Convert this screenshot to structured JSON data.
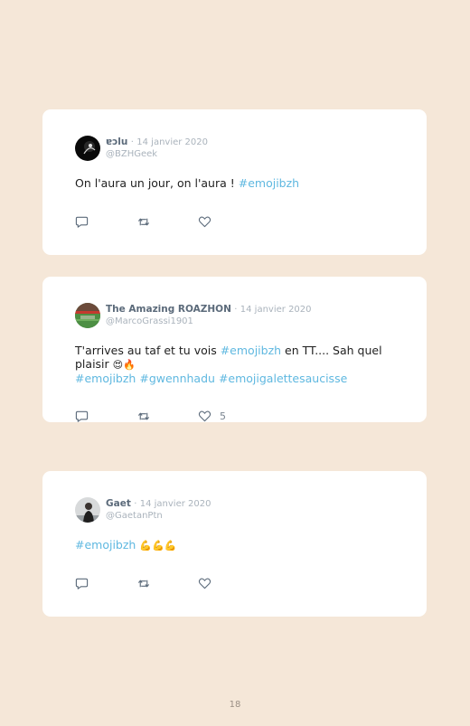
{
  "tweets": [
    {
      "author": "ɐɔlu",
      "separator": "·",
      "date": "14 janvier 2020",
      "handle": "@BZHGeek",
      "text_plain": "On l'aura un jour, on l'aura ! ",
      "hashtag": "#emojibzh",
      "likes": ""
    },
    {
      "author": "The Amazing ROAZHON",
      "separator": "·",
      "date": "14 janvier 2020",
      "handle": "@MarcoGrassi1901",
      "text_before": "T'arrives au taf et tu vois ",
      "hashtag_inline": "#emojibzh",
      "text_after": " en TT.... Sah quel plaisir ",
      "emojis": "😍🔥",
      "hashtags_line": [
        "#emojibzh",
        "#gwennhadu",
        "#emojigalettesaucisse"
      ],
      "likes": "5"
    },
    {
      "author": "Gaet",
      "separator": "·",
      "date": "14 janvier 2020",
      "handle": "@GaetanPtn",
      "hashtag": "#emojibzh",
      "emojis": "💪💪💪",
      "likes": ""
    }
  ],
  "icons": {
    "reply": "reply-icon",
    "retweet": "retweet-icon",
    "like": "heart-icon"
  },
  "colors": {
    "page_background": "#f5e7d8",
    "card_background": "#ffffff",
    "hashtag": "#5fb8e0",
    "author": "#5b6a7a",
    "muted": "#aab3bc"
  },
  "page": {
    "number": "18"
  }
}
